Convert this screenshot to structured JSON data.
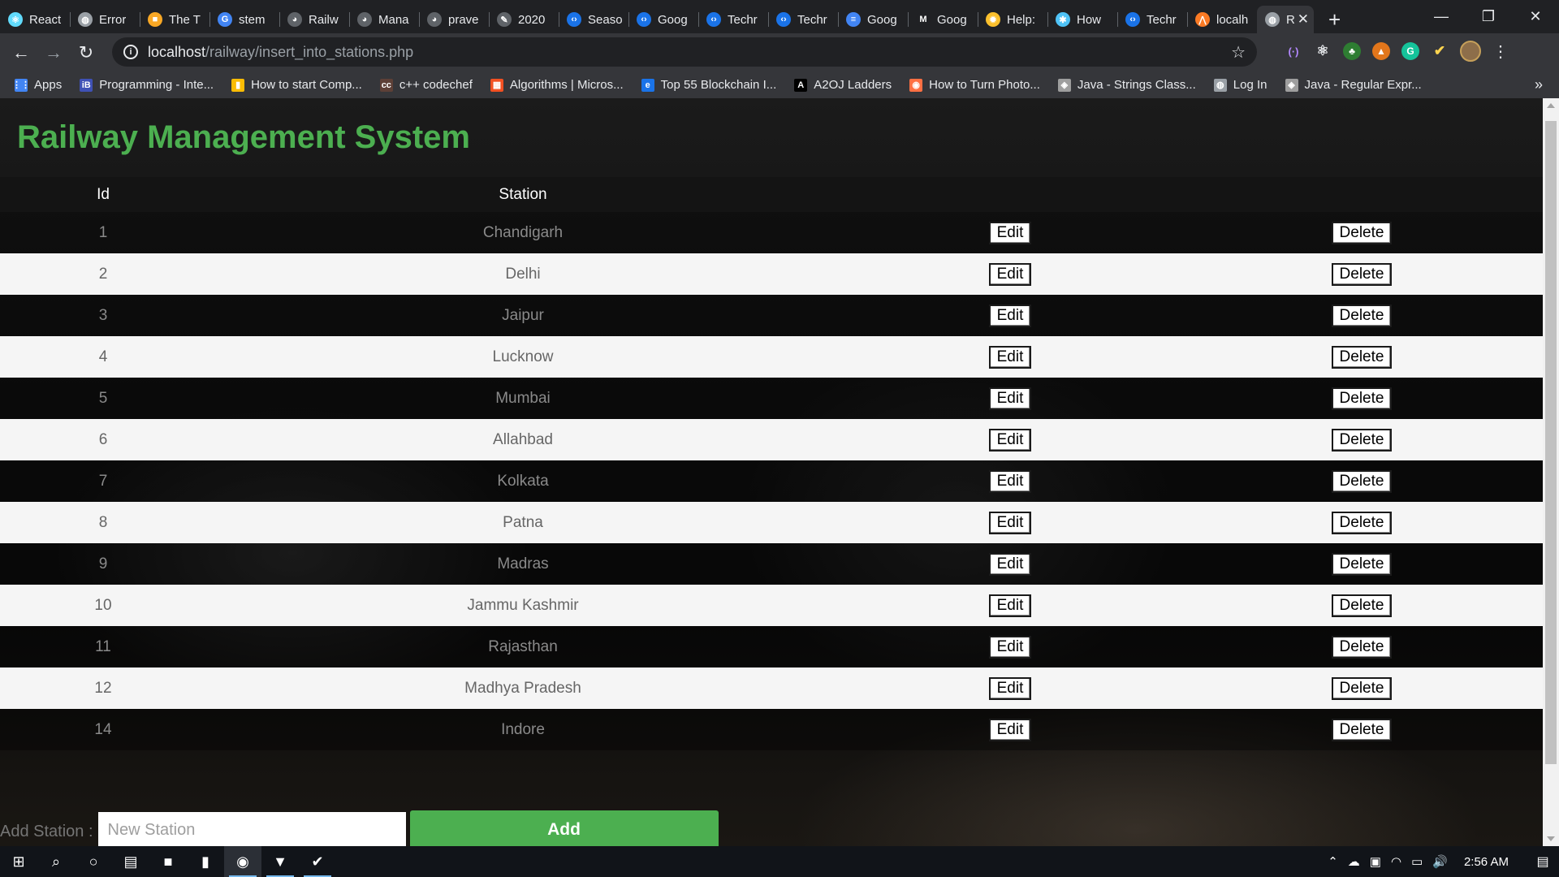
{
  "tabs": [
    {
      "label": "React",
      "icon": "react-icon",
      "color": "#61dafb"
    },
    {
      "label": "Error",
      "icon": "globe-icon",
      "color": "#9aa0a6"
    },
    {
      "label": "The T",
      "icon": "bookmark-icon",
      "color": "#f9a825"
    },
    {
      "label": "stem",
      "icon": "google-icon",
      "color": "#4285f4"
    },
    {
      "label": "Railw",
      "icon": "github-icon",
      "color": "#5f6368"
    },
    {
      "label": "Mana",
      "icon": "github-icon",
      "color": "#5f6368"
    },
    {
      "label": "prave",
      "icon": "github-icon",
      "color": "#5f6368"
    },
    {
      "label": "2020",
      "icon": "feather-icon",
      "color": "#5f6368"
    },
    {
      "label": "Seaso",
      "icon": "code-icon",
      "color": "#1a73e8"
    },
    {
      "label": "Goog",
      "icon": "code-icon",
      "color": "#1a73e8"
    },
    {
      "label": "Techr",
      "icon": "code-icon",
      "color": "#1a73e8"
    },
    {
      "label": "Techr",
      "icon": "code-icon",
      "color": "#1a73e8"
    },
    {
      "label": "Goog",
      "icon": "docs-icon",
      "color": "#4285f4"
    },
    {
      "label": "Goog",
      "icon": "medium-icon",
      "color": "#202124"
    },
    {
      "label": "Help:",
      "icon": "gear-icon",
      "color": "#fbc02d"
    },
    {
      "label": "How",
      "icon": "puzzle-icon",
      "color": "#4fc3f7"
    },
    {
      "label": "Techr",
      "icon": "code-icon",
      "color": "#1a73e8"
    },
    {
      "label": "localh",
      "icon": "xampp-icon",
      "color": "#fb7a24"
    }
  ],
  "active_tab": {
    "label": "R",
    "icon": "globe-icon"
  },
  "new_tab_symbol": "+",
  "window_controls": {
    "minimize": "—",
    "maximize": "❐",
    "close": "✕"
  },
  "address_bar": {
    "host": "localhost",
    "path": "/railway/insert_into_stations.php"
  },
  "bookmarks": [
    {
      "label": "Apps",
      "icon": "apps-grid-icon",
      "color": "#4285f4"
    },
    {
      "label": "Programming - Inte...",
      "icon": "ib-icon",
      "color": "#3f51b5"
    },
    {
      "label": "How to start Comp...",
      "icon": "bar-chart-icon",
      "color": "#fbbc05"
    },
    {
      "label": "c++ codechef",
      "icon": "codechef-icon",
      "color": "#5d4037"
    },
    {
      "label": "Algorithms | Micros...",
      "icon": "microsoft-icon",
      "color": "#f25022"
    },
    {
      "label": "Top 55 Blockchain I...",
      "icon": "edureka-icon",
      "color": "#1a73e8"
    },
    {
      "label": "A2OJ Ladders",
      "icon": "a2oj-icon",
      "color": "#000000"
    },
    {
      "label": "How to Turn Photo...",
      "icon": "photo-icon",
      "color": "#ff7043"
    },
    {
      "label": "Java - Strings Class...",
      "icon": "tutorialspoint-icon",
      "color": "#9e9e9e"
    },
    {
      "label": "Log In",
      "icon": "globe-icon",
      "color": "#9aa0a6"
    },
    {
      "label": "Java - Regular Expr...",
      "icon": "tutorialspoint-icon",
      "color": "#9e9e9e"
    }
  ],
  "bookmarks_more": "»",
  "page": {
    "title": "Railway Management System",
    "title_color": "#4caf50",
    "table": {
      "headers": {
        "id": "Id",
        "station": "Station"
      },
      "edit_label": "Edit",
      "delete_label": "Delete",
      "rows": [
        {
          "id": "1",
          "station": "Chandigarh"
        },
        {
          "id": "2",
          "station": "Delhi"
        },
        {
          "id": "3",
          "station": "Jaipur"
        },
        {
          "id": "4",
          "station": "Lucknow"
        },
        {
          "id": "5",
          "station": "Mumbai"
        },
        {
          "id": "6",
          "station": "Allahbad"
        },
        {
          "id": "7",
          "station": "Kolkata"
        },
        {
          "id": "8",
          "station": "Patna"
        },
        {
          "id": "9",
          "station": "Madras"
        },
        {
          "id": "10",
          "station": "Jammu Kashmir"
        },
        {
          "id": "11",
          "station": "Rajasthan"
        },
        {
          "id": "12",
          "station": "Madhya Pradesh"
        },
        {
          "id": "14",
          "station": "Indore"
        }
      ]
    },
    "add_form": {
      "label": "Add Station :",
      "placeholder": "New Station",
      "value": "",
      "button_label": "Add",
      "button_color": "#4caf50"
    }
  },
  "taskbar": {
    "apps": [
      {
        "name": "windows-start-icon",
        "glyph": "⊞"
      },
      {
        "name": "search-icon",
        "glyph": "⌕"
      },
      {
        "name": "cortana-icon",
        "glyph": "○"
      },
      {
        "name": "task-view-icon",
        "glyph": "▤"
      },
      {
        "name": "file-explorer-icon",
        "glyph": "■"
      },
      {
        "name": "office-icon",
        "glyph": "▮"
      },
      {
        "name": "chrome-icon",
        "glyph": "◉"
      },
      {
        "name": "brave-icon",
        "glyph": "▼"
      },
      {
        "name": "todo-icon",
        "glyph": "✔"
      }
    ],
    "tray": [
      "⌃",
      "☁",
      "▣",
      "◠",
      "▭",
      "🔊"
    ],
    "clock": "2:56 AM"
  }
}
